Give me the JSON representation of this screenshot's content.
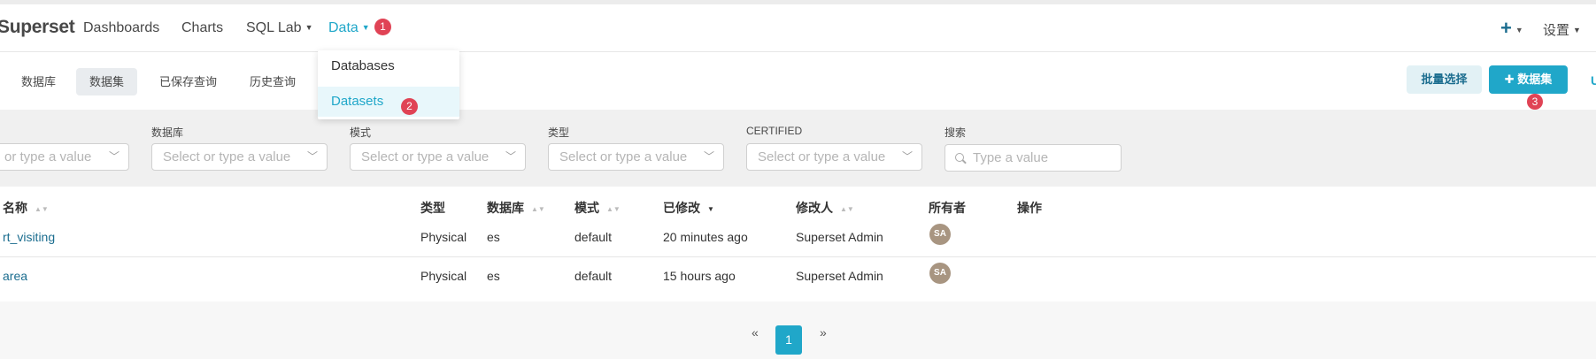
{
  "navbar": {
    "brand": "Superset",
    "items": [
      {
        "label": "Dashboards"
      },
      {
        "label": "Charts"
      },
      {
        "label": "SQL Lab"
      },
      {
        "label": "Data"
      }
    ],
    "plus": "+",
    "settings_label": "设置",
    "badges": [
      "1",
      "2",
      "3"
    ]
  },
  "dropdown": {
    "items": [
      {
        "label": "Databases"
      },
      {
        "label": "Datasets"
      }
    ]
  },
  "subnav": {
    "tabs": [
      {
        "label": "数据库"
      },
      {
        "label": "数据集"
      },
      {
        "label": "已保存查询"
      },
      {
        "label": "历史查询"
      }
    ],
    "bulk_select": "批量选择",
    "add_dataset": "数据集",
    "truncated_right": "U"
  },
  "filters": {
    "first_select_text": "or type a value",
    "labels": [
      "数据库",
      "模式",
      "类型",
      "CERTIFIED",
      "搜索"
    ],
    "select_placeholder": "Select or type a value",
    "search_placeholder": "Type a value"
  },
  "table": {
    "headers": [
      "名称",
      "类型",
      "数据库",
      "模式",
      "已修改",
      "修改人",
      "所有者",
      "操作"
    ],
    "rows": [
      {
        "name": "rt_visiting",
        "type": "Physical",
        "database": "es",
        "schema": "default",
        "modified": "20 minutes ago",
        "modified_by": "Superset Admin",
        "owner": "SA"
      },
      {
        "name": "area",
        "type": "Physical",
        "database": "es",
        "schema": "default",
        "modified": "15 hours ago",
        "modified_by": "Superset Admin",
        "owner": "SA"
      }
    ]
  },
  "pagination": {
    "prev": "«",
    "current": "1",
    "next": "»"
  },
  "colors": {
    "primary": "#20a7c9",
    "badge": "#e04355",
    "link": "#1b6d8f"
  }
}
